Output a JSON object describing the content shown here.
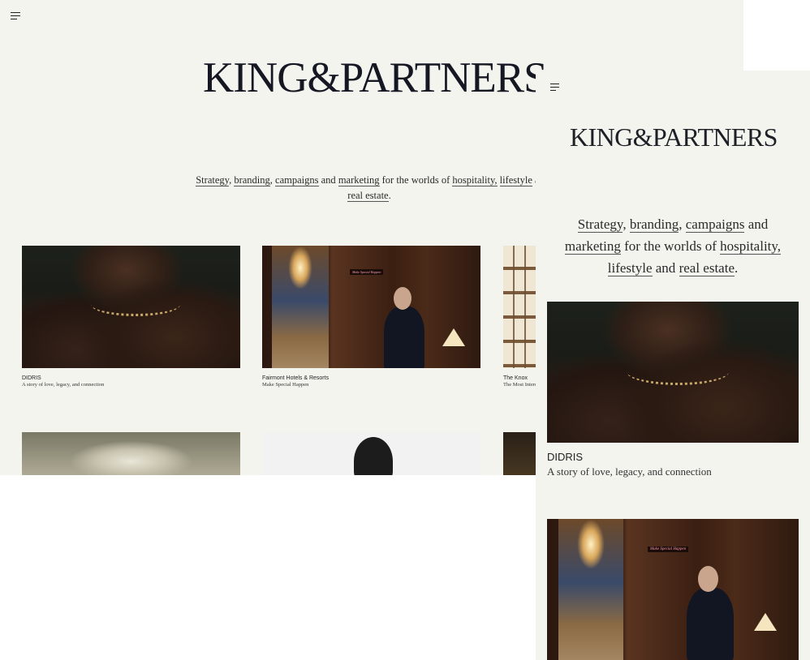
{
  "brand": {
    "logo_text": "KING&PARTNERS"
  },
  "menu": {
    "icon": "hamburger-menu-icon"
  },
  "tagline": {
    "strategy": "Strategy",
    "sep1": ", ",
    "branding": "branding",
    "sep2": ", ",
    "campaigns": "campaigns",
    "and1": " and ",
    "marketing": "marketing",
    "middle": " for the worlds of ",
    "hospitality": "hospitality,",
    "space": " ",
    "lifestyle": "lifestyle",
    "and2": " and ",
    "real_estate": "real estate",
    "end": ".",
    "desktop_trunc": "ar"
  },
  "projects": [
    {
      "title": "DIDRIS",
      "subtitle": "A story of love, legacy, and connection"
    },
    {
      "title": "Fairmont Hotels & Resorts",
      "subtitle": "Make Special Happen"
    },
    {
      "title": "The Knox",
      "subtitle": "The Most Intere"
    }
  ],
  "hotel_sign": "Make Special Happen",
  "colors": {
    "background": "#f4f4ef",
    "text": "#1a1a1a",
    "logo": "#151823"
  }
}
